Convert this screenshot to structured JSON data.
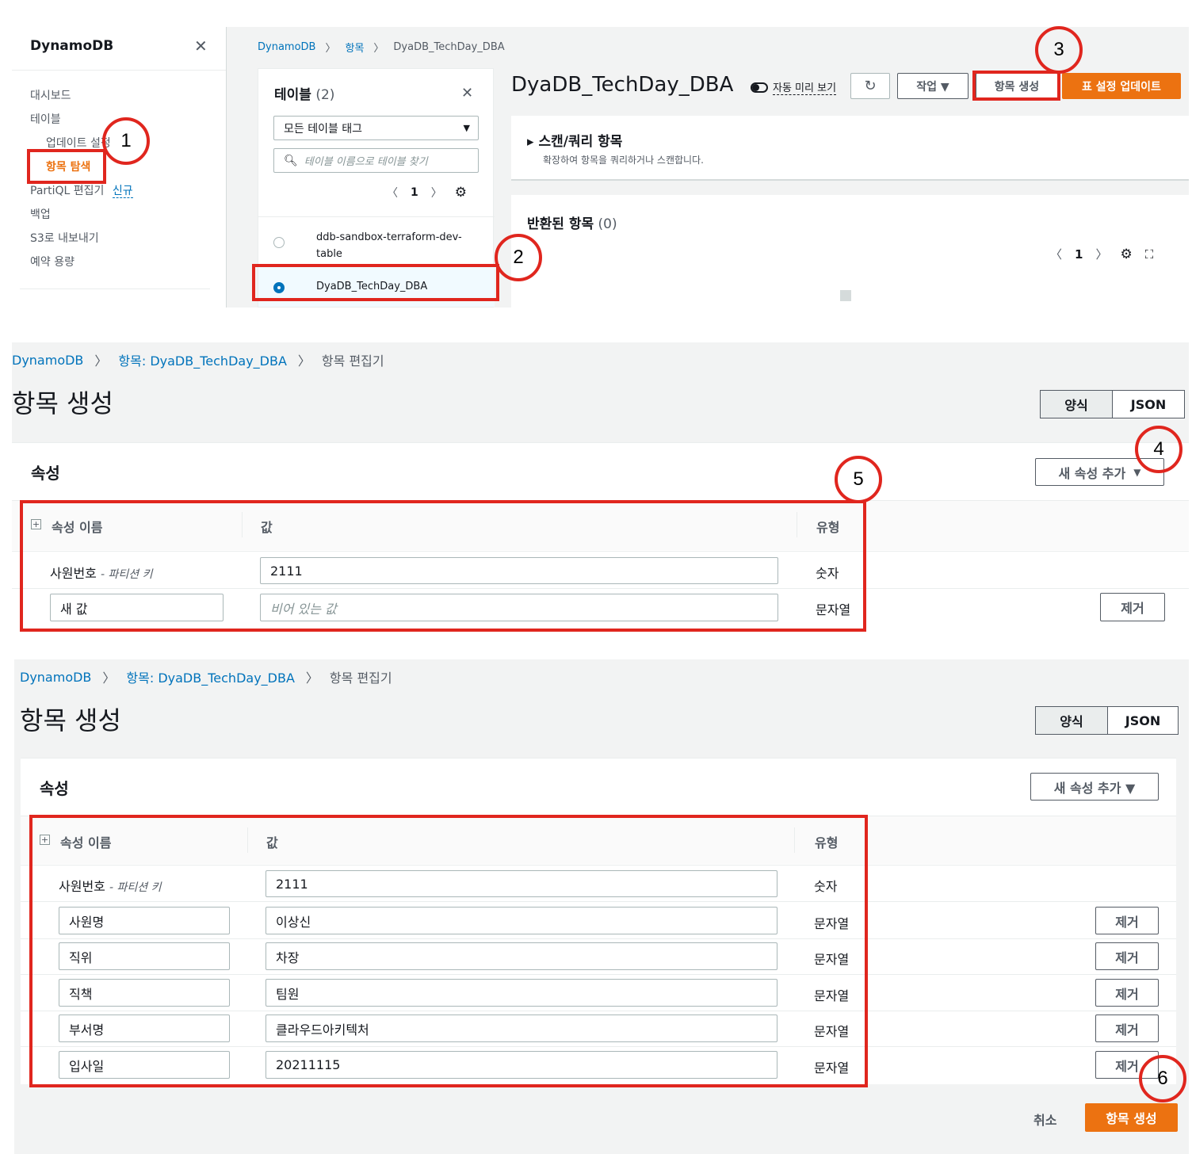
{
  "panel1": {
    "sidebar": {
      "title": "DynamoDB",
      "close": "✕",
      "items": [
        "대시보드",
        "테이블",
        "업데이트 설정",
        "항목 탐색",
        "PartiQL 편집기",
        "백업",
        "S3로 내보내기",
        "예약 용량"
      ],
      "new_badge": "신규"
    },
    "breadcrumb": [
      "DynamoDB",
      "항목",
      "DyaDB_TechDay_DBA"
    ],
    "tables_panel": {
      "title": "테이블",
      "count": "(2)",
      "close": "✕",
      "tag_filter": "모든 테이블 태그",
      "search_placeholder": "테이블 이름으로 테이블 찾기",
      "page": "1",
      "tables": [
        "ddb-sandbox-terraform-dev-table",
        "DyaDB_TechDay_DBA"
      ]
    },
    "main": {
      "title": "DyaDB_TechDay_DBA",
      "auto_preview": "자동 미리 보기",
      "actions": "작업 ▼",
      "create_item": "항목 생성",
      "update_table": "표 설정 업데이트",
      "scan_title": "스캔/쿼리 항목",
      "scan_desc": "확장하여 항목을 쿼리하거나 스캔합니다.",
      "returned_title": "반환된 항목",
      "returned_count": "(0)",
      "page": "1"
    }
  },
  "panel2": {
    "breadcrumb": [
      "DynamoDB",
      "항목: DyaDB_TechDay_DBA",
      "항목 편집기"
    ],
    "title": "항목 생성",
    "tab_form": "양식",
    "tab_json": "JSON",
    "section": "속성",
    "add_attr": "새 속성 추가",
    "headers": {
      "name": "속성 이름",
      "value": "값",
      "type": "유형"
    },
    "pk_name": "사원번호",
    "pk_suffix": "- 파티션 키",
    "pk_value": "2111",
    "pk_type": "숫자",
    "new_name": "새 값",
    "new_value_placeholder": "비어 있는 값",
    "new_type": "문자열",
    "remove": "제거"
  },
  "panel3": {
    "breadcrumb": [
      "DynamoDB",
      "항목: DyaDB_TechDay_DBA",
      "항목 편집기"
    ],
    "title": "항목 생성",
    "tab_form": "양식",
    "tab_json": "JSON",
    "section": "속성",
    "add_attr": "새 속성 추가 ▼",
    "headers": {
      "name": "속성 이름",
      "value": "값",
      "type": "유형"
    },
    "pk_name": "사원번호",
    "pk_suffix": "- 파티션 키",
    "pk_value": "2111",
    "pk_type": "숫자",
    "rows": [
      {
        "name": "사원명",
        "value": "이상신",
        "type": "문자열"
      },
      {
        "name": "직위",
        "value": "차장",
        "type": "문자열"
      },
      {
        "name": "직책",
        "value": "팀원",
        "type": "문자열"
      },
      {
        "name": "부서명",
        "value": "클라우드아키텍처",
        "type": "문자열"
      },
      {
        "name": "입사일",
        "value": "20211115",
        "type": "문자열"
      }
    ],
    "remove": "제거",
    "cancel": "취소",
    "create": "항목 생성"
  },
  "callouts": [
    "1",
    "2",
    "3",
    "4",
    "5",
    "6"
  ]
}
